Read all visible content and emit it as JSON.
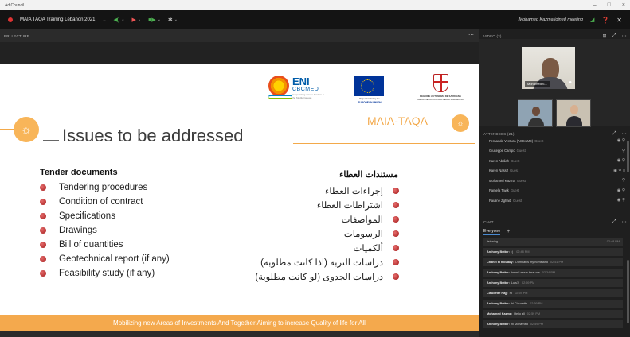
{
  "window": {
    "title": "Ad Council",
    "controls": [
      "–",
      "□",
      "×"
    ]
  },
  "toolbar": {
    "meeting_title": "MAIA TAQA Training Lebanon 2021",
    "mic_icon": "◀)",
    "video_icon": "▶",
    "share_icon": "■▶",
    "more_icon": "✱",
    "chevron": "⌄",
    "notification": "Mohamed Kazma joined meeting",
    "signal_icon": "◢",
    "help_icon": "❓",
    "close_icon": "✕"
  },
  "stage": {
    "label": "BRI LECTURE",
    "more": "⋯"
  },
  "slide": {
    "eni": {
      "name": "ENI",
      "sub": "CBCMED",
      "tagline": "Cooperating across borders in the Mediterranean"
    },
    "eu": {
      "line1": "Project funded by the",
      "line2": "EUROPEAN UNION"
    },
    "sardegna": {
      "line1": "REGIONE AUTONOMA DE SARDIGNA",
      "line2": "REGIONE AUTONOMA DELLA SARDEGNA"
    },
    "bulb_icon": "☼",
    "title": "Issues to be addressed",
    "maia": "MAIA-TAQA",
    "list_head_en": "Tender documents",
    "items_en": [
      "Tendering procedures",
      "Condition of contract",
      "Specifications",
      "Drawings",
      "Bill of quantities",
      "Geotechnical report (if any)",
      "Feasibility study (if any)"
    ],
    "list_head_ar": "مستندات العطاء",
    "items_ar": [
      "إجراءات العطاء",
      "اشتراطات العطاء",
      "المواصفات",
      "الرسومات",
      "ألكميات",
      "دراسات التربة (اذا كانت مطلوبة)",
      "دراسات الجدوى (لو كانت مطلوبة)"
    ],
    "banner": "Mobilizing new Areas of Investments And Together Aiming to increase Quality of life for All",
    "colors": {
      "accent": "#f3a94a",
      "banner": "#f4a94d",
      "title": "#3c3c3c"
    }
  },
  "video": {
    "header": "VIDEO (3)",
    "layout_icon": "⊞",
    "expand_icon": "⤢",
    "more": "⋯",
    "main_label": "Mohamed S..."
  },
  "attendees": {
    "header": "ATTENDEES (21)",
    "expand_icon": "⤢",
    "more": "⋯",
    "rows": [
      {
        "name": "Fernanda Ventura (ASCAME)",
        "role": "Guest",
        "icons": "◉ ⚲"
      },
      {
        "name": "Giuseppe Campo",
        "role": "Guest",
        "icons": "⚲"
      },
      {
        "name": "Karen Abdiah",
        "role": "Guest",
        "icons": "◉ ⚲"
      },
      {
        "name": "Karen Nassif",
        "role": "Guest",
        "icons": "◉ ⚲ ▯"
      },
      {
        "name": "Mohamed Kazma",
        "role": "Guest",
        "icons": "⚲"
      },
      {
        "name": "Pamela Tawk",
        "role": "Guest",
        "icons": "◉ ⚲"
      },
      {
        "name": "Pauline Zghaib",
        "role": "Guest",
        "icons": "◉ ⚲"
      }
    ]
  },
  "chat": {
    "header": "CHAT",
    "expand_icon": "⤢",
    "more": "⋯",
    "tab": "Everyone",
    "add": "+",
    "first": {
      "text": "listening",
      "time": "02:48 PM"
    },
    "messages": [
      {
        "author": "Anthony Butter:",
        "text": ":) ",
        "time": "02:48 PM"
      },
      {
        "author": "Chanel el hibuaoy:",
        "text": "Oumpat is my homeland",
        "time": "02:51 PM"
      },
      {
        "author": "Anthony Butter:",
        "text": "hmm I see a bear me",
        "time": "02:34 PM"
      },
      {
        "author": "Anthony Butter:",
        "text": "Luis?!",
        "time": "02:59 PM"
      },
      {
        "author": "Claudette Hajj:",
        "text": "Hi",
        "time": "02:59 PM"
      },
      {
        "author": "Anthony Butter:",
        "text": "hi Claudette",
        "time": "02:59 PM"
      },
      {
        "author": "Mohamed Kazma:",
        "text": "Hello all",
        "time": "02:59 PM"
      },
      {
        "author": "Anthony Butter:",
        "text": "hi Mohamed",
        "time": "02:59 PM"
      }
    ]
  }
}
